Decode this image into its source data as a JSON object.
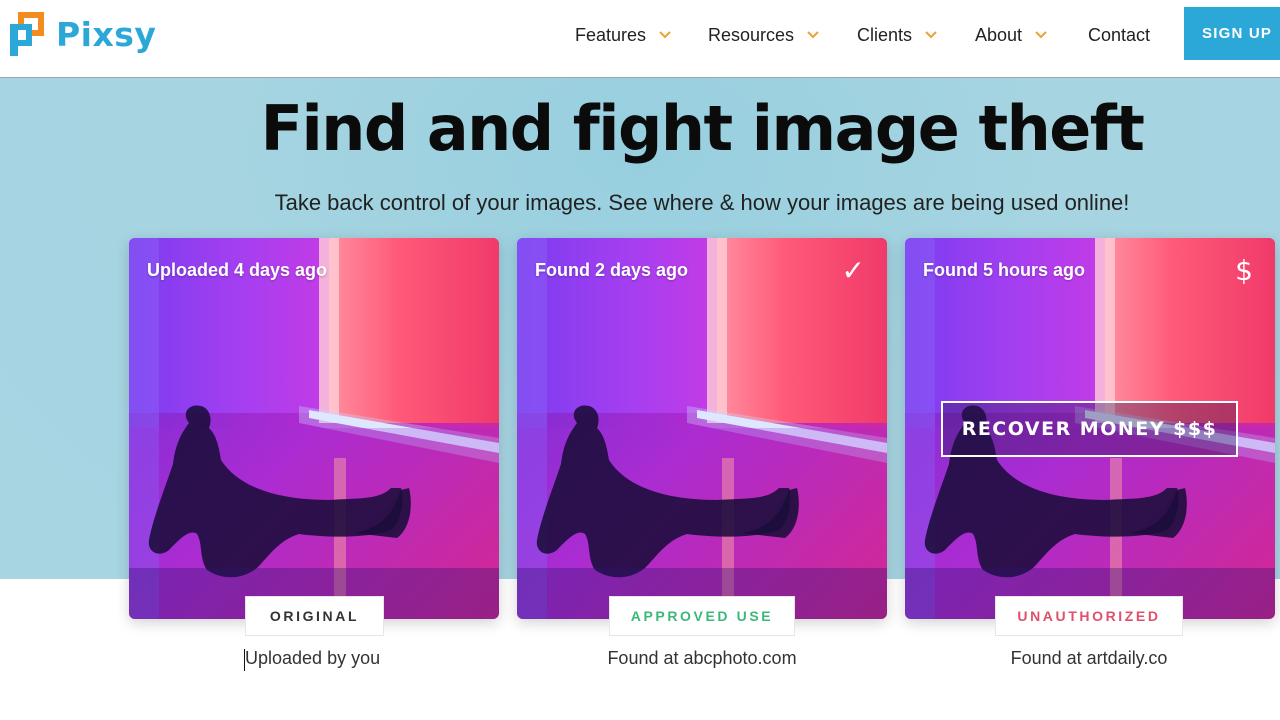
{
  "brand": {
    "name": "Pixsy",
    "color_text": "#2ca8d8",
    "color_orange": "#f28c1c",
    "color_blue": "#2ca8d8"
  },
  "nav": {
    "items": [
      {
        "label": "Features",
        "has_dropdown": true
      },
      {
        "label": "Resources",
        "has_dropdown": true
      },
      {
        "label": "Clients",
        "has_dropdown": true
      },
      {
        "label": "About",
        "has_dropdown": true
      },
      {
        "label": "Contact",
        "has_dropdown": false
      }
    ],
    "chevron_color": "#f0a030",
    "signup_label": "SIGN UP"
  },
  "hero": {
    "title": "Find and fight image theft",
    "subtitle": "Take back control of your images. See where & how your images are being used online!",
    "background": "#a8d5e2"
  },
  "cards": [
    {
      "caption": "Uploaded 4 days ago",
      "icon": "",
      "tag": "ORIGINAL",
      "tag_color": "#333333",
      "footer": "Uploaded by you"
    },
    {
      "caption": "Found 2 days ago",
      "icon": "✓",
      "tag": "APPROVED USE",
      "tag_color": "#3cb878",
      "footer": "Found at abcphoto.com"
    },
    {
      "caption": "Found 5 hours ago",
      "icon": "$",
      "tag": "UNAUTHORIZED",
      "tag_color": "#e0506a",
      "footer": "Found at artdaily.co",
      "button": "RECOVER MONEY $$$"
    }
  ]
}
